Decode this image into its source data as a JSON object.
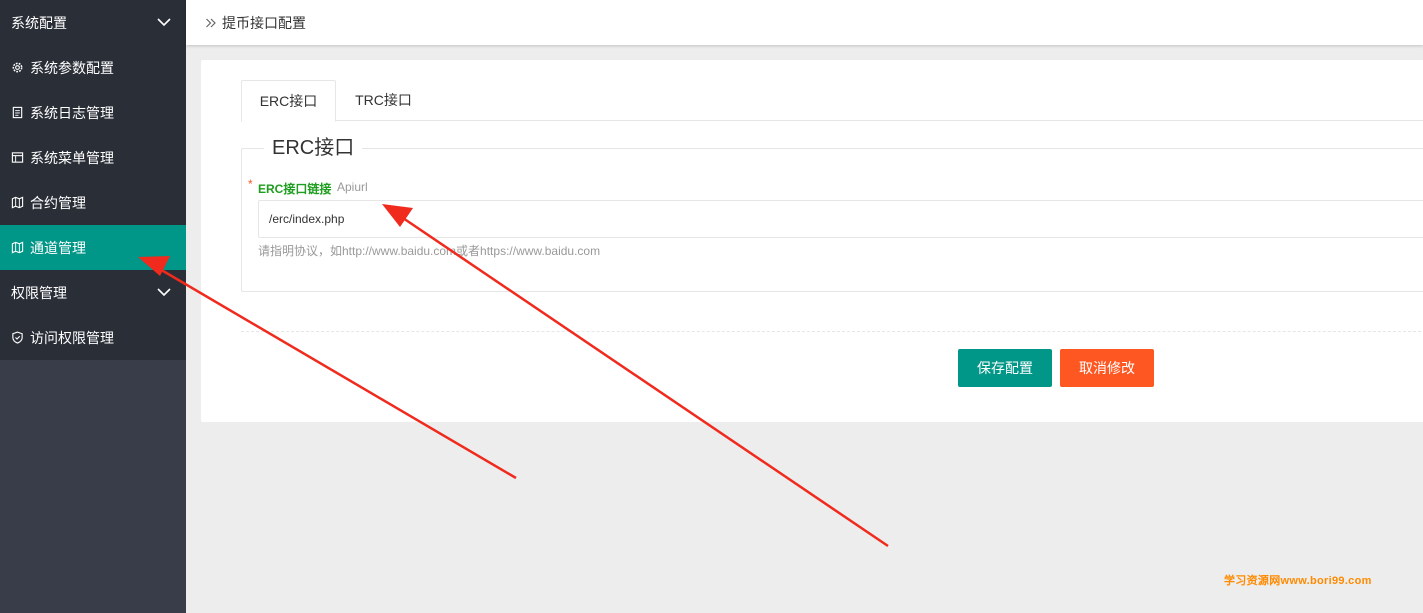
{
  "sidebar": {
    "groups": [
      {
        "label": "系统配置",
        "items": [
          {
            "label": "系统参数配置",
            "icon": "gear-icon"
          },
          {
            "label": "系统日志管理",
            "icon": "clipboard-icon"
          },
          {
            "label": "系统菜单管理",
            "icon": "window-icon"
          },
          {
            "label": "合约管理",
            "icon": "map-icon"
          },
          {
            "label": "通道管理",
            "icon": "map-icon",
            "active": true
          }
        ]
      },
      {
        "label": "权限管理",
        "items": [
          {
            "label": "访问权限管理",
            "icon": "shield-icon"
          }
        ]
      }
    ]
  },
  "breadcrumb": {
    "icon": "double-chevron-right-icon",
    "label": "提币接口配置"
  },
  "tabs": [
    {
      "label": "ERC接口",
      "active": true
    },
    {
      "label": "TRC接口",
      "active": false
    }
  ],
  "form": {
    "legend": "ERC接口",
    "required_mark": "*",
    "field_label": "ERC接口链接",
    "field_sublabel": "Apiurl",
    "field_value": "/erc/index.php",
    "hint": "请指明协议，如http://www.baidu.com或者https://www.baidu.com"
  },
  "buttons": {
    "save": "保存配置",
    "cancel": "取消修改"
  },
  "watermark": "学习资源网www.bori99.com",
  "colors": {
    "sidebar_bg": "#393d49",
    "active": "#009688",
    "danger": "#ff5722",
    "label_green": "#1e9e1e",
    "annotation_arrow": "#f02a1d"
  }
}
